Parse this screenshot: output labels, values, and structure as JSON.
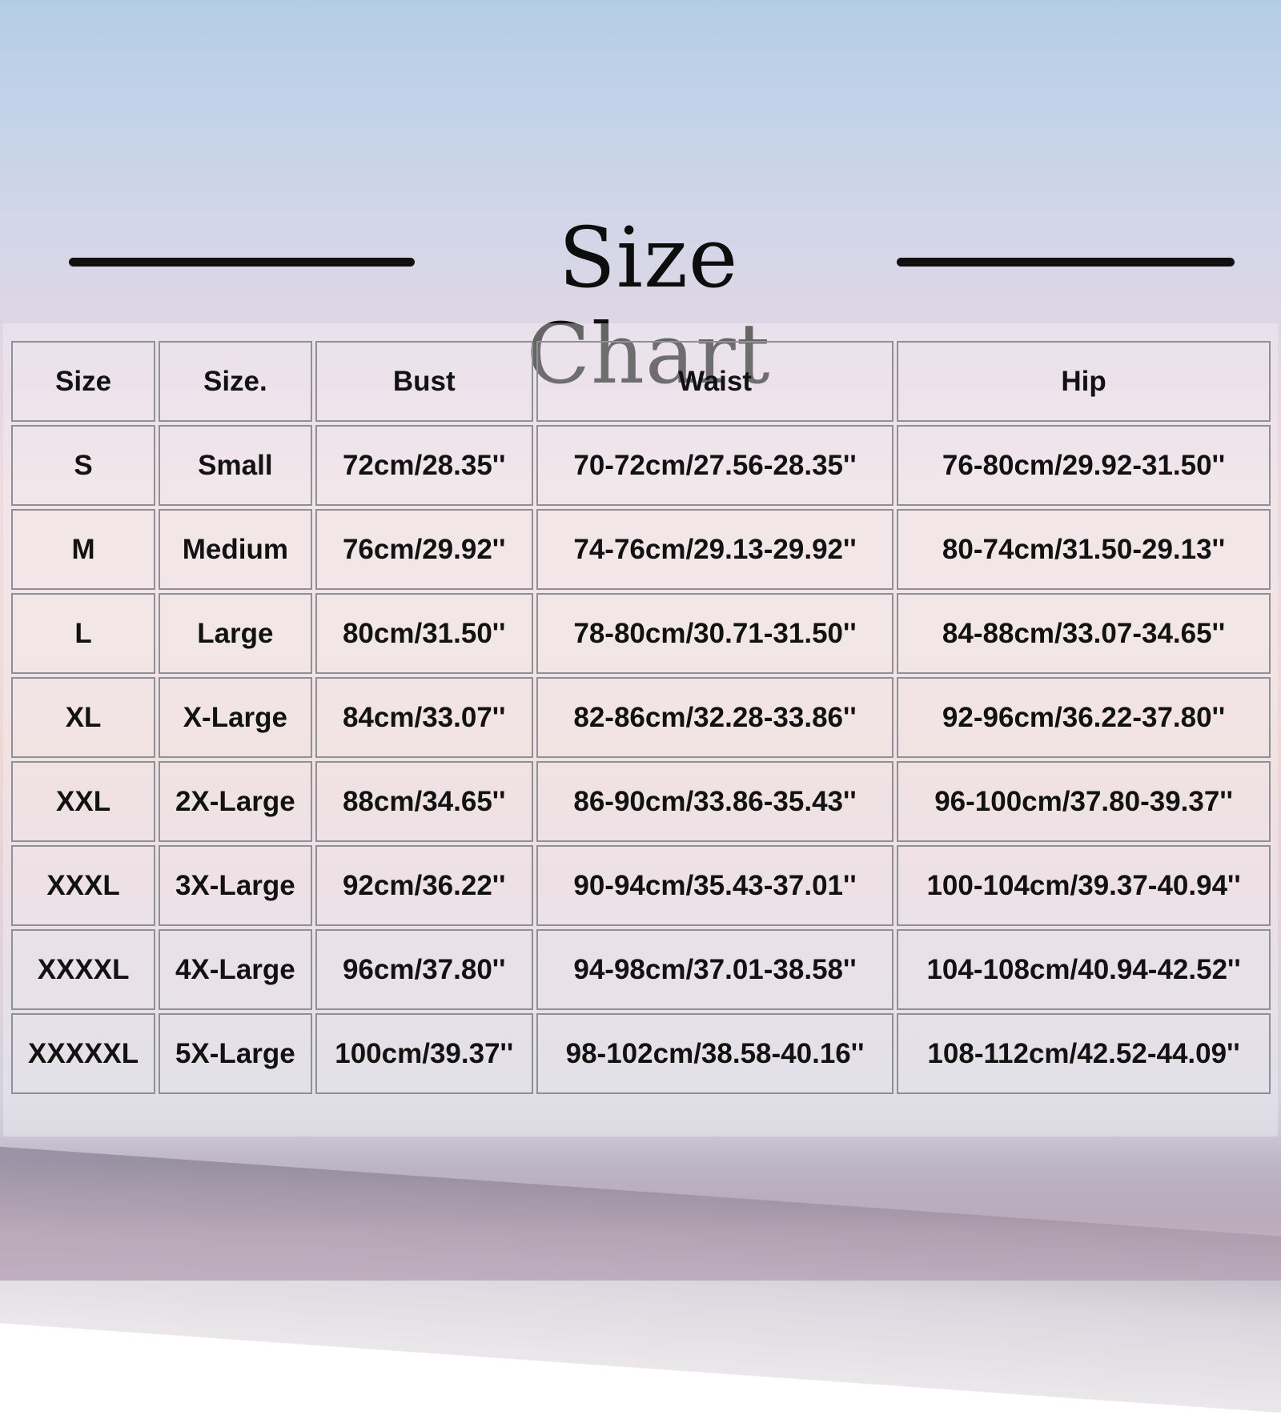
{
  "title": "Size Chart",
  "colors": {
    "text": "#121212",
    "grid_border": "#8f8f97",
    "rule": "#111111"
  },
  "table": {
    "headers": [
      "Size",
      "Size.",
      "Bust",
      "Waist",
      "Hip"
    ],
    "rows": [
      [
        "S",
        "Small",
        "72cm/28.35''",
        "70-72cm/27.56-28.35''",
        "76-80cm/29.92-31.50''"
      ],
      [
        "M",
        "Medium",
        "76cm/29.92''",
        "74-76cm/29.13-29.92''",
        "80-74cm/31.50-29.13''"
      ],
      [
        "L",
        "Large",
        "80cm/31.50''",
        "78-80cm/30.71-31.50''",
        "84-88cm/33.07-34.65''"
      ],
      [
        "XL",
        "X-Large",
        "84cm/33.07''",
        "82-86cm/32.28-33.86''",
        "92-96cm/36.22-37.80''"
      ],
      [
        "XXL",
        "2X-Large",
        "88cm/34.65''",
        "86-90cm/33.86-35.43''",
        "96-100cm/37.80-39.37''"
      ],
      [
        "XXXL",
        "3X-Large",
        "92cm/36.22''",
        "90-94cm/35.43-37.01''",
        "100-104cm/39.37-40.94''"
      ],
      [
        "XXXXL",
        "4X-Large",
        "96cm/37.80''",
        "94-98cm/37.01-38.58''",
        "104-108cm/40.94-42.52''"
      ],
      [
        "XXXXXL",
        "5X-Large",
        "100cm/39.37''",
        "98-102cm/38.58-40.16''",
        "108-112cm/42.52-44.09''"
      ]
    ]
  }
}
